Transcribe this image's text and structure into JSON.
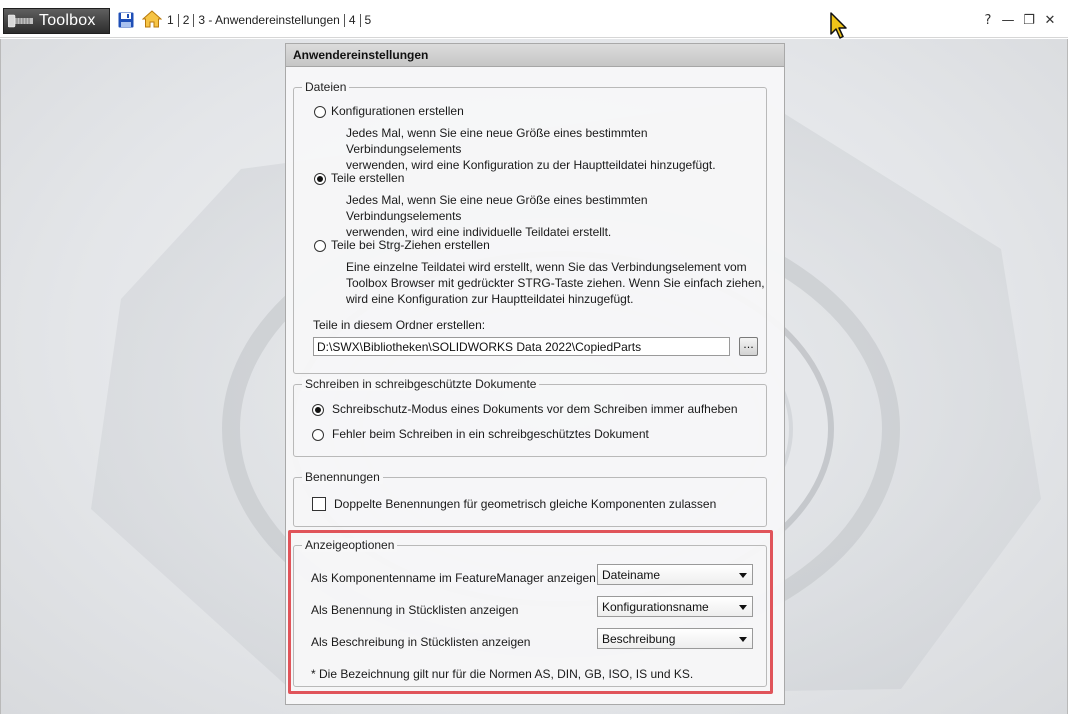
{
  "app": {
    "title": "Toolbox",
    "breadcrumb": [
      "1",
      "2",
      "3 - Anwendereinstellungen",
      "4",
      "5"
    ],
    "window_controls": {
      "help": "?",
      "minimize": "—",
      "restore": "❐",
      "close": "✕"
    }
  },
  "icons": {
    "logo": "bolt-icon",
    "save": "floppy-disk-icon",
    "home": "home-icon",
    "cursor": "mouse-pointer-icon"
  },
  "colors": {
    "highlight": "#e0545a",
    "save_icon": "#1f4fb7",
    "home_icon": "#e3a21a"
  },
  "panel": {
    "title": "Anwendereinstellungen",
    "dateien": {
      "title": "Dateien",
      "options": [
        {
          "label": "Konfigurationen erstellen",
          "checked": false,
          "desc1": "Jedes Mal, wenn Sie eine neue Größe eines bestimmten Verbindungselements",
          "desc2": "verwenden, wird eine Konfiguration zu der Hauptteildatei hinzugefügt.",
          "desc3": ""
        },
        {
          "label": "Teile erstellen",
          "checked": true,
          "desc1": "Jedes Mal, wenn Sie eine neue Größe eines bestimmten Verbindungselements",
          "desc2": "verwenden, wird eine individuelle Teildatei erstellt.",
          "desc3": ""
        },
        {
          "label": "Teile bei Strg-Ziehen erstellen",
          "checked": false,
          "desc1": "Eine einzelne Teildatei wird erstellt, wenn Sie das Verbindungselement vom",
          "desc2": "Toolbox Browser mit gedrückter STRG-Taste ziehen. Wenn Sie einfach ziehen,",
          "desc3": "wird eine Konfiguration zur Hauptteildatei hinzugefügt."
        }
      ],
      "folder_label": "Teile in diesem Ordner erstellen:",
      "folder_value": "D:\\SWX\\Bibliotheken\\SOLIDWORKS Data 2022\\CopiedParts",
      "browse_label": "..."
    },
    "schreiben": {
      "title": "Schreiben in schreibgeschützte Dokumente",
      "options": [
        {
          "label": "Schreibschutz-Modus eines Dokuments vor dem Schreiben immer aufheben",
          "checked": true
        },
        {
          "label": "Fehler beim Schreiben in ein schreibgeschütztes Dokument",
          "checked": false
        }
      ]
    },
    "benennungen": {
      "title": "Benennungen",
      "checkbox_label": "Doppelte Benennungen für geometrisch gleiche Komponenten zulassen",
      "checked": false
    },
    "anzeige": {
      "title": "Anzeigeoptionen",
      "rows": [
        {
          "label": "Als Komponentenname im FeatureManager anzeigen",
          "value": "Dateiname"
        },
        {
          "label": "Als Benennung in Stücklisten anzeigen",
          "value": "Konfigurationsname"
        },
        {
          "label": "Als Beschreibung in Stücklisten anzeigen",
          "value": "Beschreibung"
        }
      ],
      "footnote": "* Die Bezeichnung gilt nur für die Normen AS, DIN, GB, ISO, IS und KS."
    }
  }
}
